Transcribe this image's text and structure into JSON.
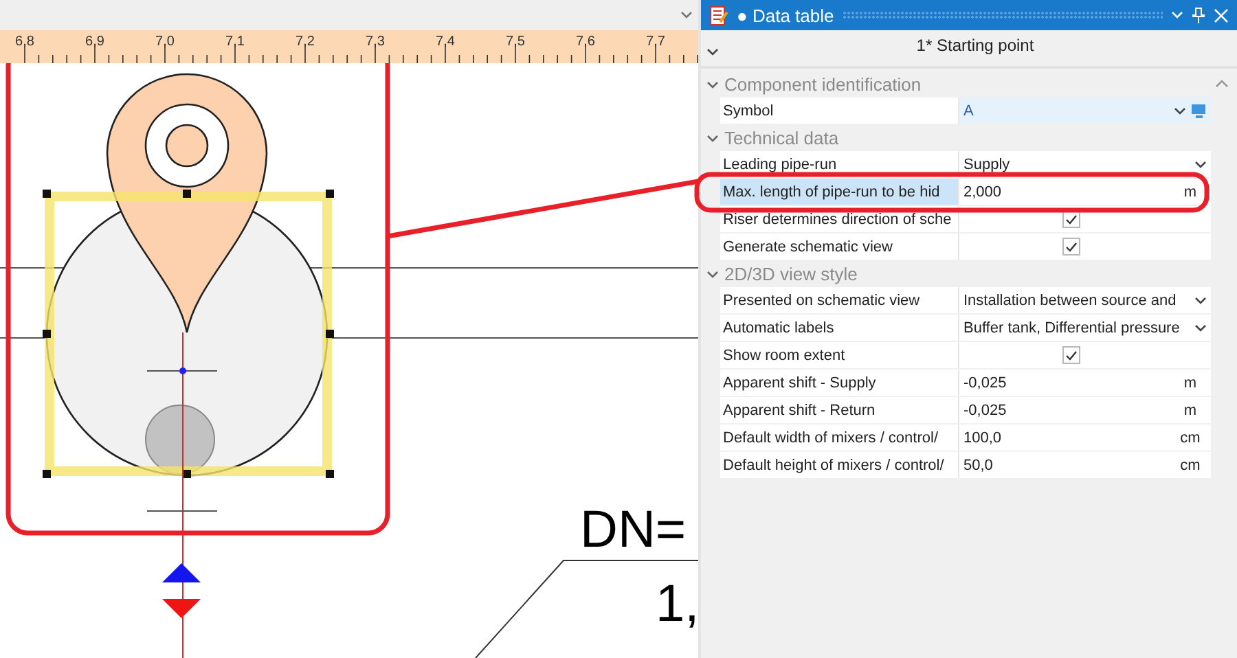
{
  "ruler": {
    "labels": [
      "6,8",
      "6,9",
      "7,0",
      "7,1",
      "7,2",
      "7,3",
      "7,4",
      "7,5",
      "7,6",
      "7,7"
    ]
  },
  "drawing": {
    "dimension_label": "DN=",
    "value_label": "1,"
  },
  "panel": {
    "marker": "●",
    "title": "Data table",
    "header": "1* Starting point",
    "sections": [
      {
        "title": "Component identification",
        "expanded": true,
        "rows": [
          {
            "kind": "symbol",
            "name": "Symbol",
            "value": "A",
            "selected": false
          }
        ]
      },
      {
        "title": "Technical data",
        "expanded": true,
        "rows": [
          {
            "kind": "dropdown",
            "name": "Leading pipe-run",
            "value": "Supply",
            "selected": false
          },
          {
            "kind": "number",
            "name": "Max. length of pipe-run to be hid",
            "value": "2,000",
            "unit": "m",
            "selected": true
          },
          {
            "kind": "checkbox",
            "name": "Riser determines direction of sche",
            "checked": true,
            "selected": false
          },
          {
            "kind": "checkbox",
            "name": "Generate schematic view",
            "checked": true,
            "selected": false
          }
        ]
      },
      {
        "title": "2D/3D view style",
        "expanded": true,
        "rows": [
          {
            "kind": "dropdown",
            "name": "Presented on schematic view",
            "value": "Installation between source and",
            "selected": false
          },
          {
            "kind": "dropdown",
            "name": "Automatic labels",
            "value": "Buffer tank, Differential pressure",
            "selected": false
          },
          {
            "kind": "checkbox",
            "name": "Show room extent",
            "checked": true,
            "selected": false
          },
          {
            "kind": "number",
            "name": "Apparent shift - Supply",
            "value": "-0,025",
            "unit": "m",
            "selected": false
          },
          {
            "kind": "number",
            "name": "Apparent shift - Return",
            "value": "-0,025",
            "unit": "m",
            "selected": false
          },
          {
            "kind": "number",
            "name": "Default width of mixers / control/",
            "value": "100,0",
            "unit": "cm",
            "selected": false
          },
          {
            "kind": "number",
            "name": "Default height of mixers / control/",
            "value": "50,0",
            "unit": "cm",
            "selected": false
          }
        ]
      }
    ]
  }
}
